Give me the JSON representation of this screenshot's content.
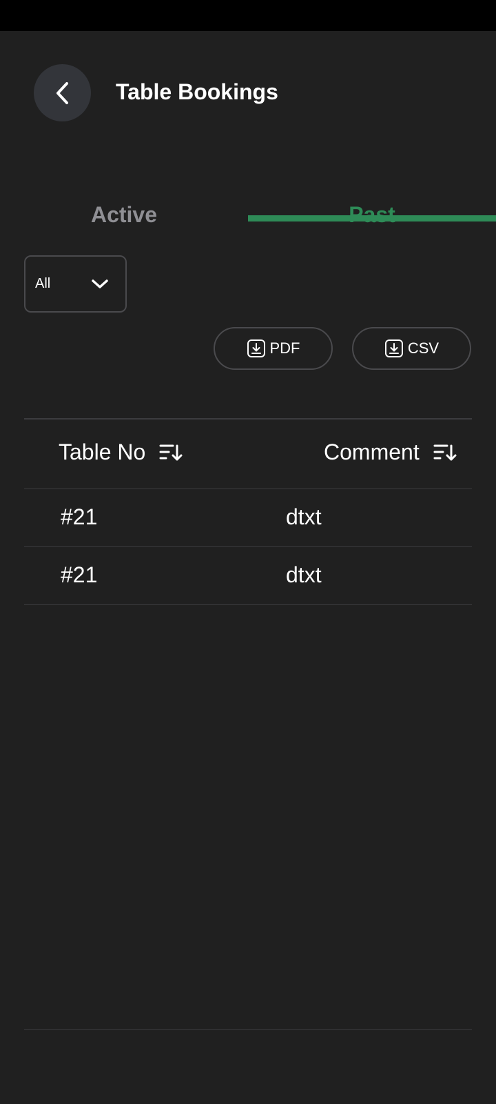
{
  "header": {
    "title": "Table Bookings"
  },
  "tabs": [
    {
      "label": "Active",
      "selected": false
    },
    {
      "label": "Past",
      "selected": true
    }
  ],
  "filter": {
    "value": "All"
  },
  "export": {
    "pdf_label": "PDF",
    "csv_label": "CSV"
  },
  "table": {
    "columns": [
      {
        "label": "Table No",
        "icon": "sort-icon"
      },
      {
        "label": "Comment",
        "icon": "sort-icon"
      }
    ],
    "rows": [
      {
        "table_no": "#21",
        "comment": "dtxt"
      },
      {
        "table_no": "#21",
        "comment": "dtxt"
      }
    ]
  },
  "colors": {
    "background": "#202020",
    "accent": "#2e8b57",
    "inactive_tab": "#8f8f94",
    "back_button_bg": "#33353a",
    "border": "#4a4a4d"
  }
}
